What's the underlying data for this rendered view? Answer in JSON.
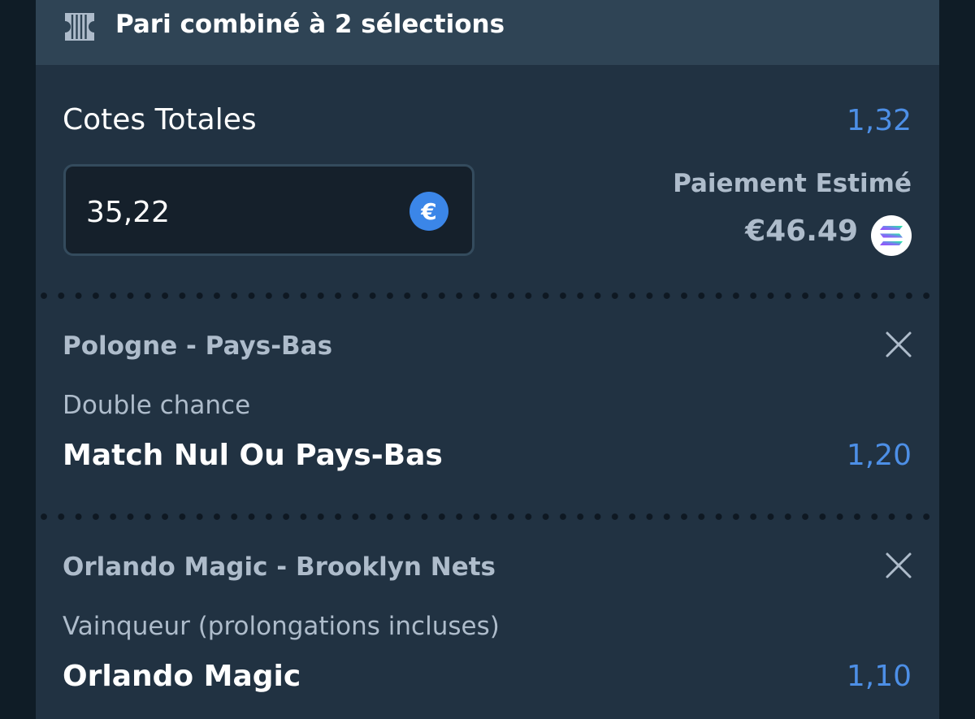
{
  "header": {
    "title": "Pari combiné à 2 sélections",
    "icon": "ticket-icon"
  },
  "summary": {
    "total_odds_label": "Cotes Totales",
    "total_odds_value": "1,32",
    "stake_value": "35,22",
    "stake_currency_icon": "euro-icon",
    "stake_currency_symbol": "€",
    "payout_label": "Paiement Estimé",
    "payout_amount": "€46.49",
    "payout_currency_icon": "solana-icon"
  },
  "legs": [
    {
      "event": "Pologne - Pays-Bas",
      "market": "Double chance",
      "selection": "Match Nul Ou Pays-Bas",
      "odds": "1,20"
    },
    {
      "event": "Orlando Magic - Brooklyn Nets",
      "market": "Vainqueur (prolongations incluses)",
      "selection": "Orlando Magic",
      "odds": "1,10"
    }
  ],
  "colors": {
    "page_background": "#0f1c26",
    "card_background": "#213242",
    "header_background": "#2f4455",
    "accent_blue": "#4d8fe6",
    "muted_text": "#aebccb",
    "primary_text": "#ffffff"
  }
}
